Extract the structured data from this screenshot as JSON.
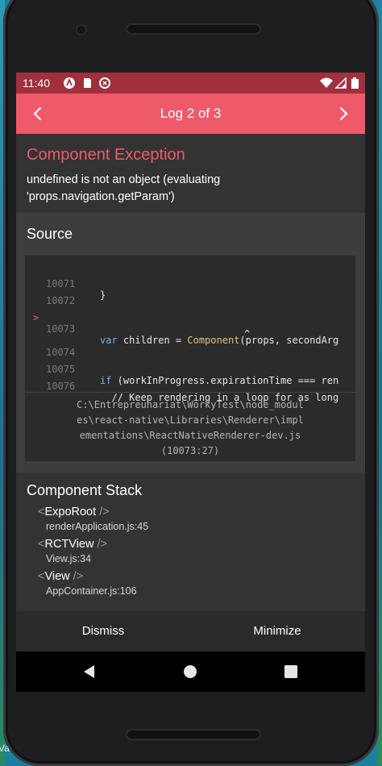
{
  "colors": {
    "accent": "#ef5a6a",
    "status_bar": "#a0303c",
    "background": "#333333",
    "code_background": "#2b2b2b"
  },
  "desktop": {
    "partial_text": "Va"
  },
  "status_bar": {
    "time": "11:40",
    "left_icons": [
      "notification-a-icon",
      "sd-card-icon",
      "data-saver-icon"
    ],
    "right_icons": [
      "wifi-icon",
      "signal-icon",
      "battery-icon"
    ]
  },
  "header": {
    "title": "Log 2 of 3",
    "prev_icon": "chevron-left-icon",
    "next_icon": "chevron-right-icon"
  },
  "exception": {
    "title": "Component Exception",
    "message_line1": "undefined is not an object (evaluating",
    "message_line2": "'props.navigation.getParam')"
  },
  "source": {
    "title": "Source",
    "lines": [
      {
        "num": "10071",
        "code": "}"
      },
      {
        "num": "10072",
        "code": ""
      },
      {
        "num": "10073",
        "marker": ">",
        "code_kw": "var",
        "code_rest1": " children = ",
        "code_fn": "Component",
        "code_rest2": "(props, secondArg"
      },
      {
        "caret": "^"
      },
      {
        "num": "10074",
        "code": ""
      },
      {
        "num": "10075",
        "code_kw": "if",
        "code_rest1": " (workInProgress.expirationTime === ren"
      },
      {
        "num": "10076",
        "comment": "  // Keep rendering in a loop for as long"
      }
    ],
    "file_path_line1": "C:\\Entrepreunariat\\WorkyTest\\node_modul",
    "file_path_line2": "es\\react-native\\Libraries\\Renderer\\impl",
    "file_path_line3": "ementations\\ReactNativeRenderer-dev.js",
    "file_path_line4": "(10073:27)"
  },
  "component_stack": {
    "title": "Component Stack",
    "items": [
      {
        "name": "ExpoRoot",
        "file": "renderApplication.js:45"
      },
      {
        "name": "RCTView",
        "file": "View.js:34"
      },
      {
        "name": "View",
        "file": "AppContainer.js:106"
      }
    ],
    "open_bracket": "<",
    "close_bracket": "/>"
  },
  "footer": {
    "dismiss_label": "Dismiss",
    "minimize_label": "Minimize"
  },
  "nav_bar": {
    "back_icon": "back-triangle-icon",
    "home_icon": "home-circle-icon",
    "recents_icon": "recents-square-icon"
  }
}
